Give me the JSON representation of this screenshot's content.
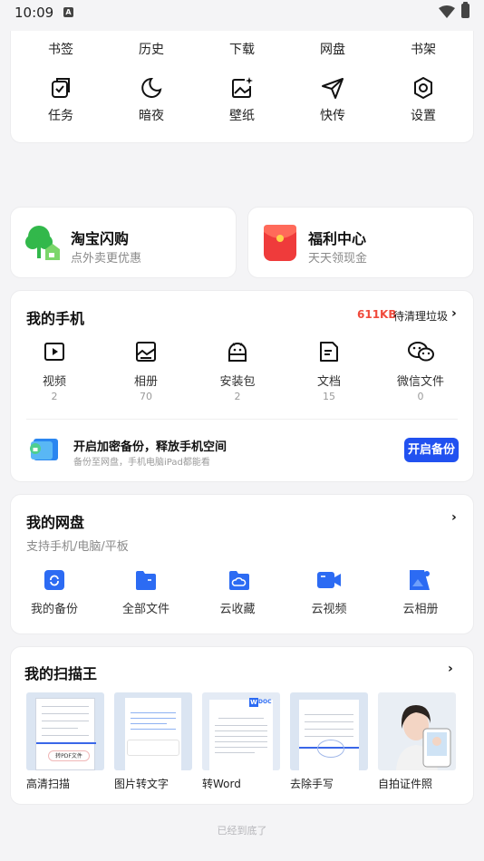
{
  "status": {
    "time": "10:09",
    "notif_badge": "A"
  },
  "tools": {
    "top_row": [
      "书签",
      "历史",
      "下载",
      "网盘",
      "书架"
    ],
    "bottom_row": [
      {
        "label": "任务",
        "icon": "task-icon"
      },
      {
        "label": "暗夜",
        "icon": "moon-icon"
      },
      {
        "label": "壁纸",
        "icon": "wallpaper-icon"
      },
      {
        "label": "快传",
        "icon": "send-icon"
      },
      {
        "label": "设置",
        "icon": "settings-icon"
      }
    ]
  },
  "promos": [
    {
      "title": "淘宝闪购",
      "subtitle": "点外卖更优惠",
      "icon": "tree-shop-icon",
      "color": "#32b84b"
    },
    {
      "title": "福利中心",
      "subtitle": "天天领现金",
      "icon": "red-envelope-icon",
      "color": "#ef3b3b"
    }
  ],
  "phone": {
    "title": "我的手机",
    "junk_size": "611KB",
    "junk_label": "待清理垃圾",
    "items": [
      {
        "label": "视频",
        "count": "2",
        "icon": "video-icon"
      },
      {
        "label": "相册",
        "count": "70",
        "icon": "album-icon"
      },
      {
        "label": "安装包",
        "count": "2",
        "icon": "apk-icon"
      },
      {
        "label": "文档",
        "count": "15",
        "icon": "document-icon"
      },
      {
        "label": "微信文件",
        "count": "0",
        "icon": "wechat-icon"
      }
    ],
    "backup_title": "开启加密备份，释放手机空间",
    "backup_subtitle": "备份至网盘，手机电脑iPad都能看",
    "backup_button": "开启备份"
  },
  "disk": {
    "title": "我的网盘",
    "subtitle": "支持手机/电脑/平板",
    "items": [
      {
        "label": "我的备份",
        "icon": "backup-icon"
      },
      {
        "label": "全部文件",
        "icon": "folder-icon"
      },
      {
        "label": "云收藏",
        "icon": "cloud-star-icon"
      },
      {
        "label": "云视频",
        "icon": "cloud-video-icon"
      },
      {
        "label": "云相册",
        "icon": "cloud-album-icon"
      }
    ]
  },
  "scanner": {
    "title": "我的扫描王",
    "items": [
      {
        "label": "高清扫描",
        "badge": "转PDF文件"
      },
      {
        "label": "图片转文字"
      },
      {
        "label": "转Word",
        "badge": "DOC"
      },
      {
        "label": "去除手写"
      },
      {
        "label": "自拍证件照"
      }
    ]
  },
  "footer": "已经到底了",
  "colors": {
    "accent": "#2151f0",
    "junk": "#f04a3c"
  }
}
